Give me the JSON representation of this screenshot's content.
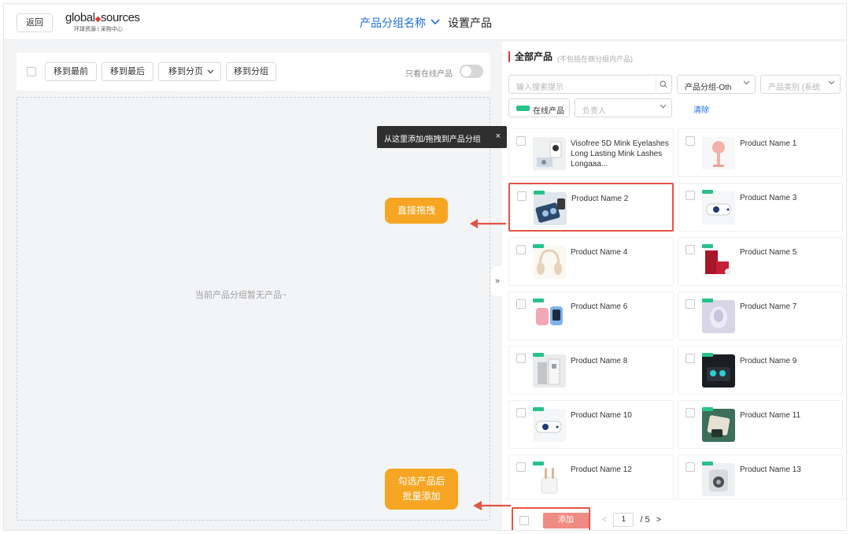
{
  "header": {
    "back_label": "返回",
    "logo_main_left": "global",
    "logo_main_right": "sources",
    "logo_sub": "环球资源 | 采购中心",
    "group_name": "产品分组名称",
    "page_title": "设置产品"
  },
  "left": {
    "buttons": [
      "移到最前",
      "移到最后",
      "移到分页",
      "移到分组"
    ],
    "online_only_label": "只看在线产品",
    "online_only_on": false,
    "empty_text": "当前产品分组暂无产品~"
  },
  "tooltip": {
    "text": "从这里添加/拖拽到产品分组",
    "close": "×"
  },
  "right": {
    "title": "全部产品",
    "subtitle": "(不包括在侧分组内产品)",
    "search_placeholder": "输入搜索提示",
    "filter_group": "产品分组-Oth",
    "filter_category": "产品类别 (系统",
    "chip_label": "在线产品",
    "owner_placeholder": "负责人",
    "clear_label": "清除",
    "products": [
      {
        "name": "Visofree 5D Mink Eyelashes Long Lasting Mink Lashes Longaaa...",
        "online": false
      },
      {
        "name": "Product Name 1",
        "online": false
      },
      {
        "name": "Product Name 2",
        "online": true
      },
      {
        "name": "Product Name 3",
        "online": true
      },
      {
        "name": "Product Name 4",
        "online": true
      },
      {
        "name": "Product Name 5",
        "online": true
      },
      {
        "name": "Product Name 6",
        "online": true
      },
      {
        "name": "Product Name 7",
        "online": true
      },
      {
        "name": "Product Name 8",
        "online": true
      },
      {
        "name": "Product Name 9",
        "online": true
      },
      {
        "name": "Product Name 10",
        "online": true
      },
      {
        "name": "Product Name 11",
        "online": true
      },
      {
        "name": "Product Name 12",
        "online": true
      },
      {
        "name": "Product Name 13",
        "online": true
      }
    ],
    "add_label": "添加",
    "pager": {
      "prev": "<",
      "current": "1",
      "total": "/ 5",
      "next": ">"
    }
  },
  "annotations": {
    "drag_hint": "直接拖拽",
    "batch_hint_line1": "勾选产品后",
    "batch_hint_line2": "批量添加"
  },
  "colors": {
    "accent_blue": "#1d6fe8",
    "highlight_red": "#e55345",
    "annotation_orange": "#f6a623",
    "online_green": "#27c28a"
  }
}
